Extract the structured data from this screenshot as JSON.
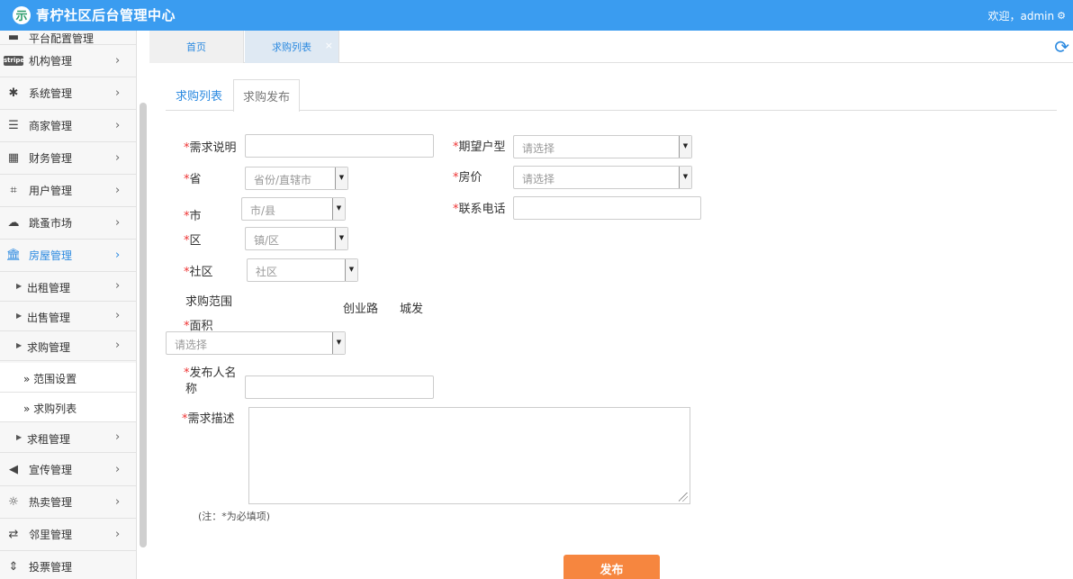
{
  "header": {
    "logo_glyph": "示",
    "title": "青柠社区后台管理中心",
    "welcome": "欢迎，admin"
  },
  "sidebar": {
    "items": [
      {
        "label": "平台配置管理",
        "icon": "monitor-icon"
      },
      {
        "label": "机构管理",
        "icon": "stripe-icon",
        "badge": "stripe"
      },
      {
        "label": "系统管理",
        "icon": "yelp-icon"
      },
      {
        "label": "商家管理",
        "icon": "list-icon"
      },
      {
        "label": "财务管理",
        "icon": "calculator-icon"
      },
      {
        "label": "用户管理",
        "icon": "crop-icon"
      },
      {
        "label": "跳蚤市场",
        "icon": "cloud-icon"
      },
      {
        "label": "房屋管理",
        "icon": "bank-icon"
      }
    ],
    "house_sub": [
      {
        "label": "出租管理"
      },
      {
        "label": "出售管理"
      },
      {
        "label": "求购管理"
      }
    ],
    "purchase_sub": [
      {
        "label": "» 范围设置"
      },
      {
        "label": "» 求购列表"
      }
    ],
    "after_items": [
      {
        "label": "求租管理"
      }
    ],
    "bottom_items": [
      {
        "label": "宣传管理",
        "icon": "volume-icon"
      },
      {
        "label": "热卖管理",
        "icon": "sun-icon"
      },
      {
        "label": "邻里管理",
        "icon": "retweet-icon"
      },
      {
        "label": "投票管理",
        "icon": "sort-icon"
      }
    ]
  },
  "tabs": [
    {
      "label": "首页"
    },
    {
      "label": "求购列表"
    }
  ],
  "subtabs": [
    {
      "label": "求购列表"
    },
    {
      "label": "求购发布"
    }
  ],
  "form": {
    "demand_label": "需求说明",
    "province_label": "省",
    "province_placeholder": "省份/直辖市",
    "city_label": "市",
    "city_placeholder": "市/县",
    "district_label": "区",
    "district_placeholder": "镇/区",
    "community_label": "社区",
    "community_placeholder": "社区",
    "range_label": "求购范围",
    "range_values": [
      "创业路",
      "城发"
    ],
    "area_label": "面积",
    "area_placeholder": "请选择",
    "publisher_label_1": "发布人名",
    "publisher_label_2": "称",
    "description_label": "需求描述",
    "house_type_label": "期望户型",
    "house_type_placeholder": "请选择",
    "price_label": "房价",
    "price_placeholder": "请选择",
    "phone_label": "联系电话",
    "required_mark": "*",
    "note": "(注：*为必填项)",
    "submit_label": "发布"
  },
  "colors": {
    "header": "#3a9cf0",
    "accent": "#2c8ae0",
    "submit": "#f6863f",
    "required": "#e33333"
  }
}
